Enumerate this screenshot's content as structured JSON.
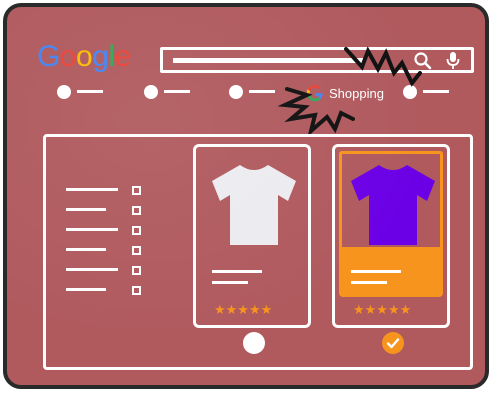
{
  "brand": {
    "logo_letters": [
      {
        "char": "G",
        "color": "#4285F4"
      },
      {
        "char": "o",
        "color": "#EA4335"
      },
      {
        "char": "o",
        "color": "#FBBC05"
      },
      {
        "char": "g",
        "color": "#4285F4"
      },
      {
        "char": "l",
        "color": "#34A853"
      },
      {
        "char": "e",
        "color": "#EA4335"
      }
    ]
  },
  "search": {
    "icons": [
      "search-icon",
      "mic-icon"
    ]
  },
  "nav": {
    "shopping_label": "Shopping",
    "shopping_icon": "google-g-icon"
  },
  "filters": {
    "count": 6
  },
  "products": [
    {
      "shirt_color": "#ecebf0",
      "stars": "★★★★★",
      "selected": false
    },
    {
      "shirt_color": "#6b00e6",
      "stars": "★★★★★",
      "selected": true
    }
  ],
  "colors": {
    "background": "#b05a5e",
    "accent": "#f7941d",
    "line": "#ffffff"
  }
}
